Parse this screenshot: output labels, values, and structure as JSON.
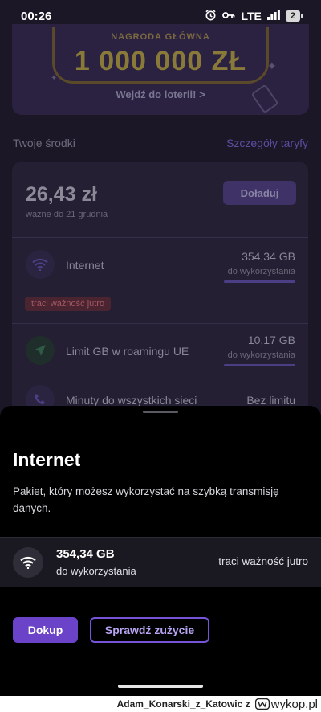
{
  "status_bar": {
    "time": "00:26",
    "network": "LTE",
    "battery": "2"
  },
  "promo": {
    "eyebrow": "NAGRODA GŁÓWNA",
    "prize": "1 000 000 ZŁ",
    "link": "Wejdź do loterii! >"
  },
  "funds": {
    "title": "Twoje środki",
    "details_link": "Szczegóły taryfy",
    "balance": "26,43 zł",
    "valid_until": "ważne do 21 grudnia",
    "topup_button": "Doładuj",
    "rows": [
      {
        "icon": "wifi-icon",
        "label": "Internet",
        "value": "354,34 GB",
        "sub": "do wykorzystania",
        "chip": "traci ważność jutro"
      },
      {
        "icon": "plane-icon",
        "label": "Limit GB w roamingu UE",
        "value": "10,17 GB",
        "sub": "do wykorzystania"
      },
      {
        "icon": "phone-icon",
        "label": "Minuty do wszystkich sieci",
        "value": "Bez limitu"
      }
    ]
  },
  "sheet": {
    "title": "Internet",
    "description": "Pakiet, który możesz wykorzystać na szybką transmisję danych.",
    "item": {
      "amount": "354,34 GB",
      "sub": "do wykorzystania",
      "warning": "traci ważność jutro"
    },
    "primary_button": "Dokup",
    "secondary_button": "Sprawdź zużycie"
  },
  "watermark": {
    "user": "Adam_Konarski_z_Katowic z",
    "site": "wykop.pl"
  },
  "colors": {
    "accent": "#6a43c8",
    "accent_outline": "#7654d8",
    "warning_chip": "#4a2430"
  }
}
